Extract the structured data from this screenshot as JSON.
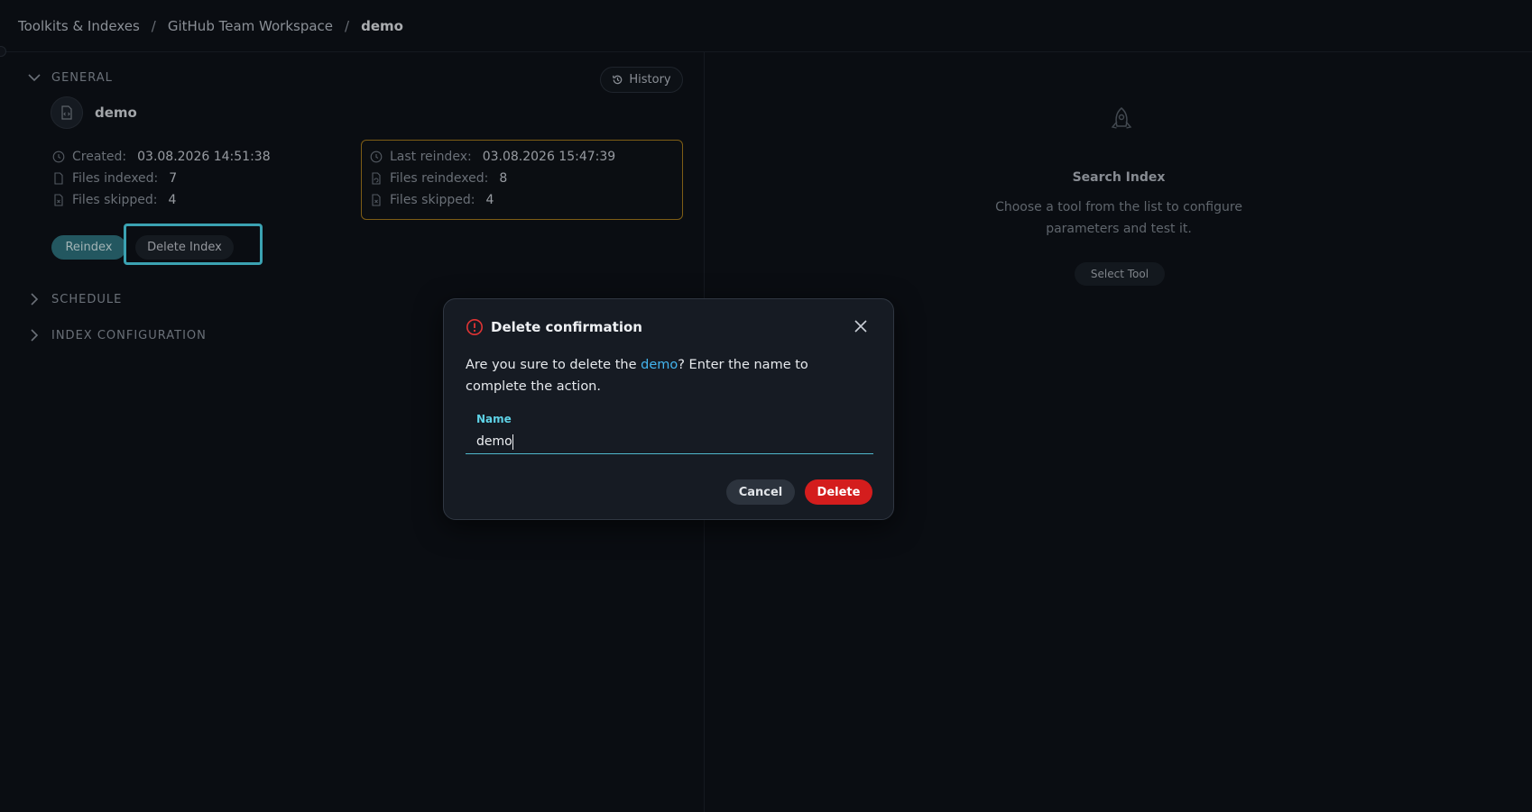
{
  "breadcrumbs": [
    "Toolkits & Indexes",
    "GitHub Team Workspace",
    "demo"
  ],
  "breadcrumb_separator": "/",
  "general": {
    "section_label": "GENERAL",
    "history_label": "History",
    "index_name": "demo",
    "created_label": "Created:",
    "created_value": "03.08.2026 14:51:38",
    "files_indexed_label": "Files indexed:",
    "files_indexed_value": "7",
    "files_skipped_label": "Files skipped:",
    "files_skipped_value": "4",
    "reindex_button": "Reindex",
    "delete_index_button": "Delete Index"
  },
  "reindex_info": {
    "last_reindex_label": "Last reindex:",
    "last_reindex_value": "03.08.2026 15:47:39",
    "files_reindexed_label": "Files reindexed:",
    "files_reindexed_value": "8",
    "files_skipped_label": "Files skipped:",
    "files_skipped_value": "4",
    "border_color": "#a87c1c"
  },
  "sections": {
    "schedule": "SCHEDULE",
    "index_configuration": "INDEX CONFIGURATION"
  },
  "search_panel": {
    "title": "Search Index",
    "description": "Choose a tool from the list to configure parameters and test it.",
    "select_tool_button": "Select Tool"
  },
  "modal": {
    "title": "Delete confirmation",
    "text_before": "Are you sure to delete the ",
    "highlight_name": "demo",
    "text_after": "? Enter the name to complete the action.",
    "field_label": "Name",
    "field_value": "demo",
    "cancel_button": "Cancel",
    "delete_button": "Delete"
  },
  "colors": {
    "background": "#0e1218",
    "accent": "#4fd8ee",
    "reindex_button": "#2f7580",
    "danger": "#d41d1d",
    "link": "#43b4ee"
  }
}
